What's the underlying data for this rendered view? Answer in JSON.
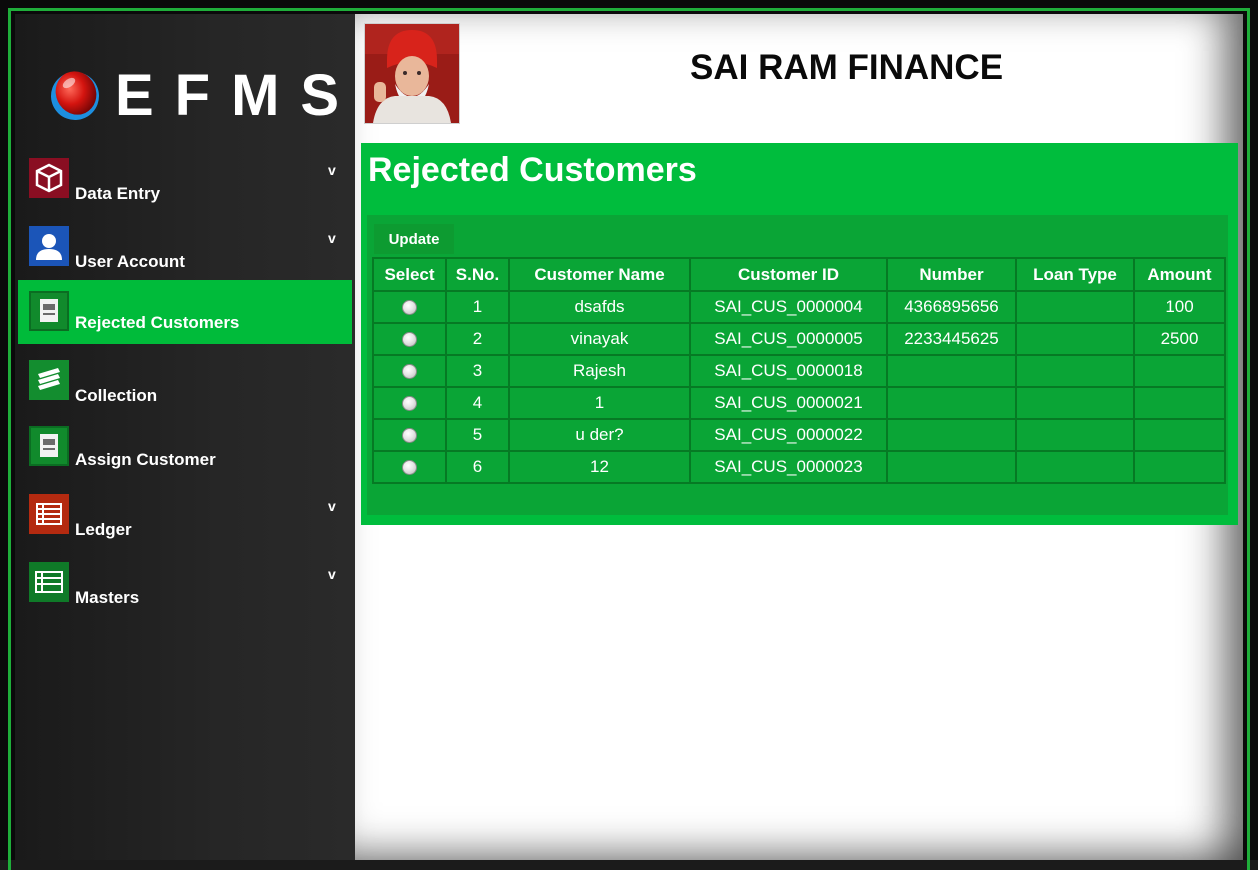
{
  "app": {
    "logo_text": "EFMS",
    "company_name": "SAI RAM FINANCE"
  },
  "sidebar": {
    "items": [
      {
        "label": "Data Entry",
        "icon": "cube-icon",
        "has_submenu": true,
        "active": false
      },
      {
        "label": "User Account",
        "icon": "user-icon",
        "has_submenu": true,
        "active": false
      },
      {
        "label": "Rejected Customers",
        "icon": "document-icon",
        "has_submenu": false,
        "active": true
      },
      {
        "label": "Collection",
        "icon": "books-icon",
        "has_submenu": false,
        "active": false
      },
      {
        "label": "Assign Customer",
        "icon": "document-icon",
        "has_submenu": false,
        "active": false
      },
      {
        "label": "Ledger",
        "icon": "ledger-icon",
        "has_submenu": true,
        "active": false
      },
      {
        "label": "Masters",
        "icon": "list-icon",
        "has_submenu": true,
        "active": false
      }
    ],
    "caret": "v"
  },
  "page": {
    "title": "Rejected Customers",
    "update_label": "Update"
  },
  "table": {
    "columns": [
      "Select",
      "S.No.",
      "Customer Name",
      "Customer ID",
      "Number",
      "Loan Type",
      "Amount"
    ],
    "rows": [
      {
        "sno": "1",
        "name": "dsafds",
        "id": "SAI_CUS_0000004",
        "number": "4366895656",
        "loan_type": "",
        "amount": "100"
      },
      {
        "sno": "2",
        "name": "vinayak",
        "id": "SAI_CUS_0000005",
        "number": "2233445625",
        "loan_type": "",
        "amount": "2500"
      },
      {
        "sno": "3",
        "name": "Rajesh",
        "id": "SAI_CUS_0000018",
        "number": "",
        "loan_type": "",
        "amount": ""
      },
      {
        "sno": "4",
        "name": "1",
        "id": "SAI_CUS_0000021",
        "number": "",
        "loan_type": "",
        "amount": ""
      },
      {
        "sno": "5",
        "name": "u der?",
        "id": "SAI_CUS_0000022",
        "number": "",
        "loan_type": "",
        "amount": ""
      },
      {
        "sno": "6",
        "name": "12",
        "id": "SAI_CUS_0000023",
        "number": "",
        "loan_type": "",
        "amount": ""
      }
    ]
  },
  "colors": {
    "accent_green": "#00bd3d",
    "active_nav": "#00bb3a",
    "sidebar_bg": "#222222"
  }
}
